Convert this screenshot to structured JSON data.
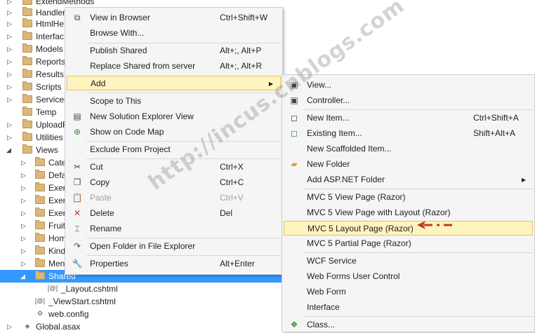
{
  "tree": {
    "items": [
      {
        "label": "ExtendMethods",
        "expander": "collapsed",
        "icon": "folder"
      },
      {
        "label": "Handler",
        "expander": "collapsed",
        "icon": "folder"
      },
      {
        "label": "HtmlHe",
        "expander": "collapsed",
        "icon": "folder"
      },
      {
        "label": "Interfac",
        "expander": "collapsed",
        "icon": "folder"
      },
      {
        "label": "Models",
        "expander": "collapsed",
        "icon": "folder"
      },
      {
        "label": "Reports",
        "expander": "collapsed",
        "icon": "folder"
      },
      {
        "label": "Results",
        "expander": "collapsed",
        "icon": "folder"
      },
      {
        "label": "Scripts",
        "expander": "collapsed",
        "icon": "folder"
      },
      {
        "label": "Services",
        "expander": "collapsed",
        "icon": "folder"
      },
      {
        "label": "Temp",
        "expander": "none",
        "icon": "folder"
      },
      {
        "label": "UploadF",
        "expander": "collapsed",
        "icon": "folder"
      },
      {
        "label": "Utilities",
        "expander": "collapsed",
        "icon": "folder"
      },
      {
        "label": "Views",
        "expander": "expanded",
        "icon": "folder"
      },
      {
        "label": "Cate",
        "expander": "collapsed",
        "icon": "folder"
      },
      {
        "label": "Defa",
        "expander": "collapsed",
        "icon": "folder"
      },
      {
        "label": "Exerc",
        "expander": "collapsed",
        "icon": "folder"
      },
      {
        "label": "Exerc",
        "expander": "collapsed",
        "icon": "folder"
      },
      {
        "label": "Exerc",
        "expander": "collapsed",
        "icon": "folder"
      },
      {
        "label": "Fruit",
        "expander": "collapsed",
        "icon": "folder"
      },
      {
        "label": "Hom",
        "expander": "collapsed",
        "icon": "folder"
      },
      {
        "label": "Kind",
        "expander": "collapsed",
        "icon": "folder"
      },
      {
        "label": "Men",
        "expander": "collapsed",
        "icon": "folder"
      },
      {
        "label": "Shared",
        "expander": "expanded",
        "icon": "folder",
        "selected": true
      },
      {
        "label": "_Layout.cshtml",
        "expander": "none",
        "icon": "@"
      },
      {
        "label": "_ViewStart.cshtml",
        "expander": "none",
        "icon": "@"
      },
      {
        "label": "web.config",
        "expander": "none",
        "icon": "config"
      },
      {
        "label": "Global.asax",
        "expander": "collapsed",
        "icon": "global"
      }
    ]
  },
  "context_menu": {
    "items": [
      {
        "label": "View in Browser",
        "shortcut": "Ctrl+Shift+W",
        "icon": "browser-icon"
      },
      {
        "label": "Browse With...",
        "shortcut": ""
      },
      {
        "label": "Publish Shared",
        "shortcut": "Alt+;, Alt+P"
      },
      {
        "label": "Replace Shared from server",
        "shortcut": "Alt+;, Alt+R"
      },
      {
        "label": "Add",
        "shortcut": ""
      },
      {
        "label": "Scope to This",
        "shortcut": ""
      },
      {
        "label": "New Solution Explorer View",
        "shortcut": "",
        "icon": "new-view-icon"
      },
      {
        "label": "Show on Code Map",
        "shortcut": "",
        "icon": "code-map-icon"
      },
      {
        "label": "Exclude From Project",
        "shortcut": ""
      },
      {
        "label": "Cut",
        "shortcut": "Ctrl+X",
        "icon": "scissors-icon"
      },
      {
        "label": "Copy",
        "shortcut": "Ctrl+C",
        "icon": "copy-icon"
      },
      {
        "label": "Paste",
        "shortcut": "Ctrl+V",
        "icon": "paste-icon"
      },
      {
        "label": "Delete",
        "shortcut": "Del",
        "icon": "delete-icon"
      },
      {
        "label": "Rename",
        "shortcut": "",
        "icon": "rename-icon"
      },
      {
        "label": "Open Folder in File Explorer",
        "shortcut": "",
        "icon": "open-folder-icon"
      },
      {
        "label": "Properties",
        "shortcut": "Alt+Enter",
        "icon": "wrench-icon"
      }
    ]
  },
  "add_submenu": {
    "items": [
      {
        "label": "View...",
        "shortcut": "",
        "icon": "view-icon"
      },
      {
        "label": "Controller...",
        "shortcut": "",
        "icon": "controller-icon"
      },
      {
        "label": "New Item...",
        "shortcut": "Ctrl+Shift+A",
        "icon": "new-item-icon"
      },
      {
        "label": "Existing Item...",
        "shortcut": "Shift+Alt+A",
        "icon": "existing-item-icon"
      },
      {
        "label": "New Scaffolded Item...",
        "shortcut": ""
      },
      {
        "label": "New Folder",
        "shortcut": "",
        "icon": "new-folder-icon"
      },
      {
        "label": "Add ASP.NET Folder",
        "shortcut": ""
      },
      {
        "label": "MVC 5 View Page (Razor)",
        "shortcut": ""
      },
      {
        "label": "MVC 5 View Page with Layout (Razor)",
        "shortcut": ""
      },
      {
        "label": "MVC 5 Layout Page (Razor)",
        "shortcut": ""
      },
      {
        "label": "MVC 5 Partial Page (Razor)",
        "shortcut": ""
      },
      {
        "label": "WCF Service",
        "shortcut": ""
      },
      {
        "label": "Web Forms User Control",
        "shortcut": ""
      },
      {
        "label": "Web Form",
        "shortcut": ""
      },
      {
        "label": "Interface",
        "shortcut": ""
      },
      {
        "label": "Class...",
        "shortcut": "",
        "icon": "class-icon"
      }
    ]
  },
  "watermark": "http://incus.cnblogs.com",
  "colors": {
    "selection": "#3399ff",
    "menu_highlight": "#fdf4bf",
    "annotation_arrow": "#c0392b"
  }
}
